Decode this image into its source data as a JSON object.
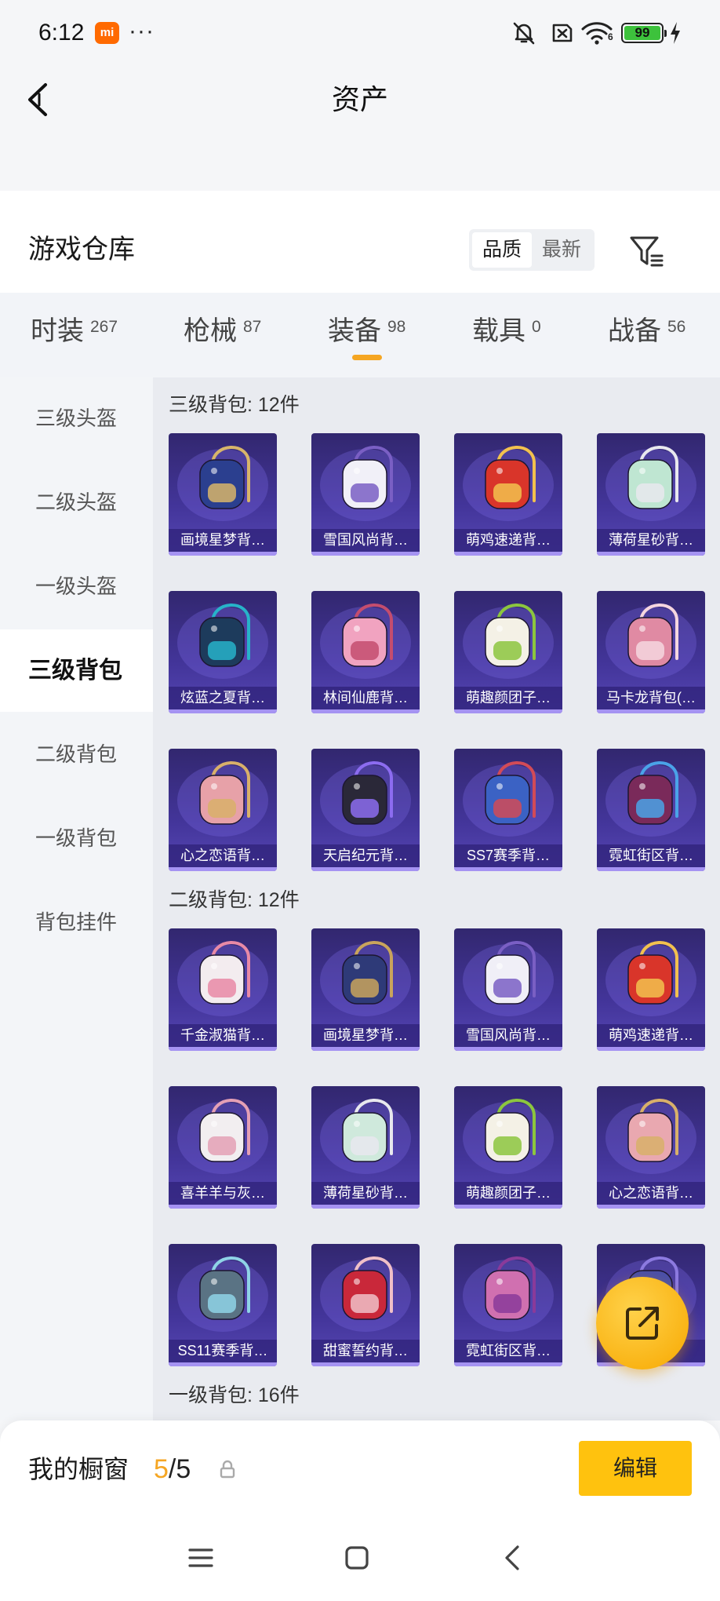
{
  "status_bar": {
    "time": "6:12",
    "mi_badge": "mi",
    "more": "···",
    "wifi_badge": "6",
    "battery": "99",
    "icons": [
      "mute-vibrate-icon",
      "sim-off-icon",
      "wifi-icon",
      "battery-icon",
      "charging-icon"
    ]
  },
  "header": {
    "back_icon": "chevron-left-icon",
    "title": "资产"
  },
  "warehouse": {
    "title": "游戏仓库",
    "sort_options": [
      {
        "label": "品质",
        "selected": true
      },
      {
        "label": "最新",
        "selected": false
      }
    ],
    "filter_icon": "filter-icon"
  },
  "tabs": [
    {
      "label": "时装",
      "count": "267",
      "active": false
    },
    {
      "label": "枪械",
      "count": "87",
      "active": false
    },
    {
      "label": "装备",
      "count": "98",
      "active": true
    },
    {
      "label": "载具",
      "count": "0",
      "active": false
    },
    {
      "label": "战备",
      "count": "56",
      "active": false
    }
  ],
  "sidebar": {
    "items": [
      {
        "label": "三级头盔",
        "active": false
      },
      {
        "label": "二级头盔",
        "active": false
      },
      {
        "label": "一级头盔",
        "active": false
      },
      {
        "label": "三级背包",
        "active": true
      },
      {
        "label": "二级背包",
        "active": false
      },
      {
        "label": "一级背包",
        "active": false
      },
      {
        "label": "背包挂件",
        "active": false
      }
    ]
  },
  "sections": [
    {
      "title": "三级背包: 12件",
      "items": [
        {
          "label": "画境星梦背…",
          "color": "#2b3f8f",
          "accent": "#d8b56a"
        },
        {
          "label": "雪国风尚背…",
          "color": "#f1f0f8",
          "accent": "#7a5fc4"
        },
        {
          "label": "萌鸡速递背…",
          "color": "#d9352a",
          "accent": "#f2c14e"
        },
        {
          "label": "薄荷星砂背…",
          "color": "#bfe6d2",
          "accent": "#e8e8ee"
        },
        {
          "label": "炫蓝之夏背…",
          "color": "#1d3b5c",
          "accent": "#27b3c9"
        },
        {
          "label": "林间仙鹿背…",
          "color": "#f1a3c0",
          "accent": "#c44d6e"
        },
        {
          "label": "萌趣颜团子…",
          "color": "#f4f1e6",
          "accent": "#8cc63e"
        },
        {
          "label": "马卡龙背包(…",
          "color": "#e08aa3",
          "accent": "#f5d6df"
        },
        {
          "label": "心之恋语背…",
          "color": "#e7a1a8",
          "accent": "#d8b06a"
        },
        {
          "label": "天启纪元背…",
          "color": "#2a2838",
          "accent": "#8c6cf0"
        },
        {
          "label": "SS7赛季背…",
          "color": "#3b62c4",
          "accent": "#d24b57"
        },
        {
          "label": "霓虹街区背…",
          "color": "#7a2a5a",
          "accent": "#4aa3e8"
        }
      ]
    },
    {
      "title": "二级背包: 12件",
      "items": [
        {
          "label": "千金淑猫背…",
          "color": "#f3ecef",
          "accent": "#e88aa6"
        },
        {
          "label": "画境星梦背…",
          "color": "#2e3a78",
          "accent": "#c9a45c"
        },
        {
          "label": "雪国风尚背…",
          "color": "#f0eff7",
          "accent": "#7a5fc4"
        },
        {
          "label": "萌鸡速递背…",
          "color": "#d9352a",
          "accent": "#f2c14e"
        },
        {
          "label": "喜羊羊与灰…",
          "color": "#f2eef0",
          "accent": "#e4a0b5"
        },
        {
          "label": "薄荷星砂背…",
          "color": "#cfe9dc",
          "accent": "#e8e8ee"
        },
        {
          "label": "萌趣颜团子…",
          "color": "#f4f1e6",
          "accent": "#8cc63e"
        },
        {
          "label": "心之恋语背…",
          "color": "#e9a8b0",
          "accent": "#d8b06a"
        },
        {
          "label": "SS11赛季背…",
          "color": "#5a7384",
          "accent": "#8fd3e6"
        },
        {
          "label": "甜蜜誓约背…",
          "color": "#c9283a",
          "accent": "#f0c0c8"
        },
        {
          "label": "霓虹街区背…",
          "color": "#d070b0",
          "accent": "#8a3a9a"
        },
        {
          "label": "",
          "color": "#4a4fa8",
          "accent": "#8c7ae0"
        }
      ]
    },
    {
      "title": "一级背包: 16件",
      "items": []
    }
  ],
  "fab": {
    "icon": "share-icon"
  },
  "showcase": {
    "title": "我的橱窗",
    "count": "5",
    "total": "/5",
    "lock_icon": "lock-icon",
    "edit_label": "编辑"
  },
  "nav_bar": {
    "icons": [
      "menu-icon",
      "home-icon",
      "back-icon"
    ]
  },
  "colors": {
    "accent": "#f5a623",
    "brand": "#ff6a00",
    "edit": "#ffc20e",
    "fab": "#f7a800",
    "card_top": "#32276f",
    "card_bottom": "#5747b5",
    "card_edge": "#a593f2"
  }
}
